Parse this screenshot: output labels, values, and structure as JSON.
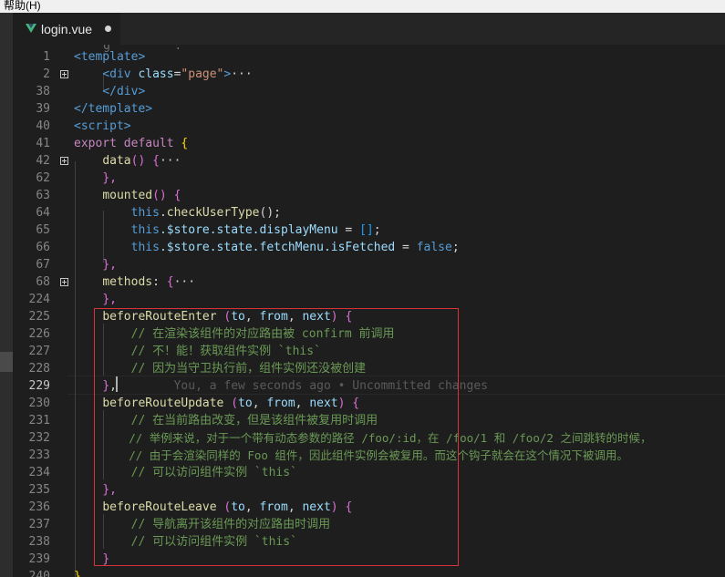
{
  "menubar": {
    "help_label": "帮助(H)"
  },
  "tab": {
    "file_name": "login.vue",
    "dirty": true,
    "icon": "vue-icon"
  },
  "editor": {
    "current_line": "229",
    "blame_text": "You, a few seconds ago • Uncommitted changes",
    "lines": [
      {
        "ln": "1",
        "code": [
          "<template>"
        ]
      },
      {
        "ln": "2",
        "code": [
          "<div",
          " class",
          "=",
          "\"page\"",
          ">",
          "···"
        ]
      },
      {
        "ln": "38",
        "code": [
          "</div>"
        ]
      },
      {
        "ln": "39",
        "code": [
          "</template>"
        ]
      },
      {
        "ln": "40",
        "code": [
          "<script>"
        ]
      },
      {
        "ln": "41",
        "code": [
          "export",
          " default",
          " {"
        ]
      },
      {
        "ln": "42",
        "code": [
          "data",
          "()",
          " {",
          "···"
        ]
      },
      {
        "ln": "62",
        "code": [
          "},"
        ]
      },
      {
        "ln": "63",
        "code": [
          "mounted",
          "()",
          " {"
        ]
      },
      {
        "ln": "64",
        "code": [
          "this",
          ".",
          "checkUserType",
          "();"
        ]
      },
      {
        "ln": "65",
        "code": [
          "this",
          ".$store.state.displayMenu",
          " = ",
          "[]",
          ";"
        ]
      },
      {
        "ln": "66",
        "code": [
          "this",
          ".$store.state.fetchMenu.isFetched",
          " = ",
          "false",
          ";"
        ]
      },
      {
        "ln": "67",
        "code": [
          "},"
        ]
      },
      {
        "ln": "68",
        "code": [
          "methods",
          ": ",
          "{",
          "···"
        ]
      },
      {
        "ln": "224",
        "code": [
          "},"
        ]
      },
      {
        "ln": "225",
        "code": [
          "beforeRouteEnter",
          " (",
          "to",
          ", ",
          "from",
          ", ",
          "next",
          ") ",
          "{"
        ]
      },
      {
        "ln": "226",
        "code": [
          "// 在渲染该组件的对应路由被 confirm 前调用"
        ]
      },
      {
        "ln": "227",
        "code": [
          "// 不！能！获取组件实例 `this`"
        ]
      },
      {
        "ln": "228",
        "code": [
          "// 因为当守卫执行前，组件实例还没被创建"
        ]
      },
      {
        "ln": "229",
        "code": [
          "}",
          ","
        ]
      },
      {
        "ln": "230",
        "code": [
          "beforeRouteUpdate",
          " (",
          "to",
          ", ",
          "from",
          ", ",
          "next",
          ") ",
          "{"
        ]
      },
      {
        "ln": "231",
        "code": [
          "// 在当前路由改变，但是该组件被复用时调用"
        ]
      },
      {
        "ln": "232",
        "code": [
          "// 举例来说，对于一个带有动态参数的路径 /foo/:id，在 /foo/1 和 /foo/2 之间跳转的时候，"
        ]
      },
      {
        "ln": "233",
        "code": [
          "// 由于会渲染同样的 Foo 组件，因此组件实例会被复用。而这个钩子就会在这个情况下被调用。"
        ]
      },
      {
        "ln": "234",
        "code": [
          "// 可以访问组件实例 `this`"
        ]
      },
      {
        "ln": "235",
        "code": [
          "},"
        ]
      },
      {
        "ln": "236",
        "code": [
          "beforeRouteLeave",
          " (",
          "to",
          ", ",
          "from",
          ", ",
          "next",
          ") ",
          "{"
        ]
      },
      {
        "ln": "237",
        "code": [
          "// 导航离开该组件的对应路由时调用"
        ]
      },
      {
        "ln": "238",
        "code": [
          "// 可以访问组件实例 `this`"
        ]
      },
      {
        "ln": "239",
        "code": [
          "}"
        ]
      },
      {
        "ln": "240",
        "code": [
          "}"
        ]
      }
    ]
  }
}
